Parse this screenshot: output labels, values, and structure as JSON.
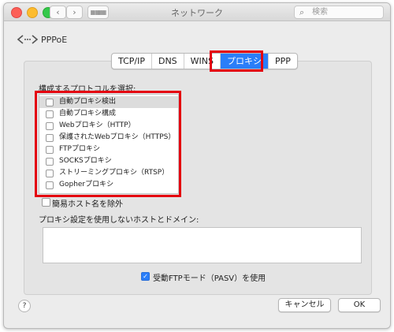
{
  "window": {
    "title": "ネットワーク"
  },
  "toolbar": {
    "back_icon": "‹",
    "forward_icon": "›",
    "grid_icon": "▦▦▦",
    "search_placeholder": "検索"
  },
  "connection": {
    "name": "PPPoE"
  },
  "tabs": [
    {
      "label": "TCP/IP",
      "selected": false
    },
    {
      "label": "DNS",
      "selected": false
    },
    {
      "label": "WINS",
      "selected": false
    },
    {
      "label": "プロキシ",
      "selected": true
    },
    {
      "label": "PPP",
      "selected": false
    }
  ],
  "proxy": {
    "protocol_label": "構成するプロトコルを選択:",
    "protocols": [
      {
        "label": "自動プロキシ検出",
        "checked": false
      },
      {
        "label": "自動プロキシ構成",
        "checked": false
      },
      {
        "label": "Webプロキシ（HTTP）",
        "checked": false
      },
      {
        "label": "保護されたWebプロキシ（HTTPS）",
        "checked": false
      },
      {
        "label": "FTPプロキシ",
        "checked": false
      },
      {
        "label": "SOCKSプロキシ",
        "checked": false
      },
      {
        "label": "ストリーミングプロキシ（RTSP）",
        "checked": false
      },
      {
        "label": "Gopherプロキシ",
        "checked": false
      }
    ],
    "exclude_simple_label": "簡易ホスト名を除外",
    "exclude_simple_checked": false,
    "bypass_label": "プロキシ設定を使用しないホストとドメイン:",
    "bypass_value": "",
    "pasv_label": "受動FTPモード（PASV）を使用",
    "pasv_checked": true
  },
  "footer": {
    "help_label": "?",
    "cancel_label": "キャンセル",
    "ok_label": "OK"
  },
  "colors": {
    "accent": "#2a7ef9",
    "highlight_box": "#e4000f"
  }
}
